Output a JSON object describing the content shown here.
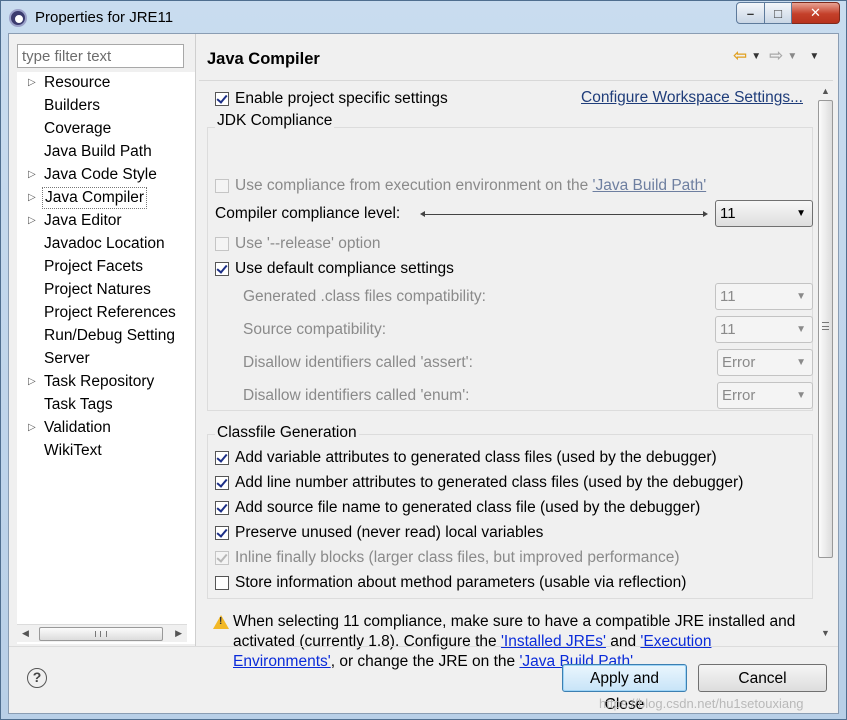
{
  "window": {
    "title": "Properties for JRE11",
    "controls": {
      "minimize": "–",
      "maximize": "□",
      "close": "✕"
    }
  },
  "filter": {
    "placeholder": "type filter text"
  },
  "tree": {
    "items": [
      {
        "label": "Resource",
        "expandable": true
      },
      {
        "label": "Builders",
        "expandable": false
      },
      {
        "label": "Coverage",
        "expandable": false
      },
      {
        "label": "Java Build Path",
        "expandable": false
      },
      {
        "label": "Java Code Style",
        "expandable": true
      },
      {
        "label": "Java Compiler",
        "expandable": true,
        "selected": true
      },
      {
        "label": "Java Editor",
        "expandable": true
      },
      {
        "label": "Javadoc Location",
        "expandable": false
      },
      {
        "label": "Project Facets",
        "expandable": false
      },
      {
        "label": "Project Natures",
        "expandable": false
      },
      {
        "label": "Project References",
        "expandable": false
      },
      {
        "label": "Run/Debug Setting",
        "expandable": false
      },
      {
        "label": "Server",
        "expandable": false
      },
      {
        "label": "Task Repository",
        "expandable": true
      },
      {
        "label": "Task Tags",
        "expandable": false
      },
      {
        "label": "Validation",
        "expandable": true
      },
      {
        "label": "WikiText",
        "expandable": false
      }
    ]
  },
  "page": {
    "title": "Java Compiler",
    "enable_specific": {
      "label": "Enable project specific settings",
      "checked": true
    },
    "configure_link": "Configure Workspace Settings...",
    "jdk": {
      "group_title": "JDK Compliance",
      "use_env": {
        "prefix": "Use compliance from execution environment on the ",
        "link": "'Java Build Path'",
        "checked": false,
        "enabled": false
      },
      "compliance_label": "Compiler compliance level:",
      "compliance_value": "11",
      "release_option": {
        "label": "Use '--release' option",
        "checked": false,
        "enabled": false
      },
      "default_settings": {
        "label": "Use default compliance settings",
        "checked": true
      },
      "settings": [
        {
          "label": "Generated .class files compatibility:",
          "value": "11"
        },
        {
          "label": "Source compatibility:",
          "value": "11"
        },
        {
          "label": "Disallow identifiers called 'assert':",
          "value": "Error"
        },
        {
          "label": "Disallow identifiers called 'enum':",
          "value": "Error"
        }
      ]
    },
    "classfile": {
      "group_title": "Classfile Generation",
      "options": [
        {
          "label": "Add variable attributes to generated class files (used by the debugger)",
          "checked": true,
          "enabled": true
        },
        {
          "label": "Add line number attributes to generated class files (used by the debugger)",
          "checked": true,
          "enabled": true
        },
        {
          "label": "Add source file name to generated class file (used by the debugger)",
          "checked": true,
          "enabled": true
        },
        {
          "label": "Preserve unused (never read) local variables",
          "checked": true,
          "enabled": true
        },
        {
          "label": "Inline finally blocks (larger class files, but improved performance)",
          "checked": true,
          "enabled": false
        },
        {
          "label": "Store information about method parameters (usable via reflection)",
          "checked": false,
          "enabled": true
        }
      ]
    },
    "warning": {
      "part1": "When selecting 11 compliance, make sure to have a compatible JRE installed and activated (currently 1.8). Configure the ",
      "link1": "'Installed JREs'",
      "part2": " and ",
      "link2": "'Execution Environments'",
      "part3": ", or change the JRE on the ",
      "link3": "'Java Build Path'",
      "part4": "."
    }
  },
  "buttons": {
    "help": "?",
    "apply_close": "Apply and Close",
    "cancel": "Cancel"
  },
  "watermark": "https://blog.csdn.net/hu1setouxiang",
  "colors": {
    "link": "#1f3d7a",
    "accent": "#3c7fb1",
    "warning": "#f2b826",
    "close": "#c4402a"
  }
}
